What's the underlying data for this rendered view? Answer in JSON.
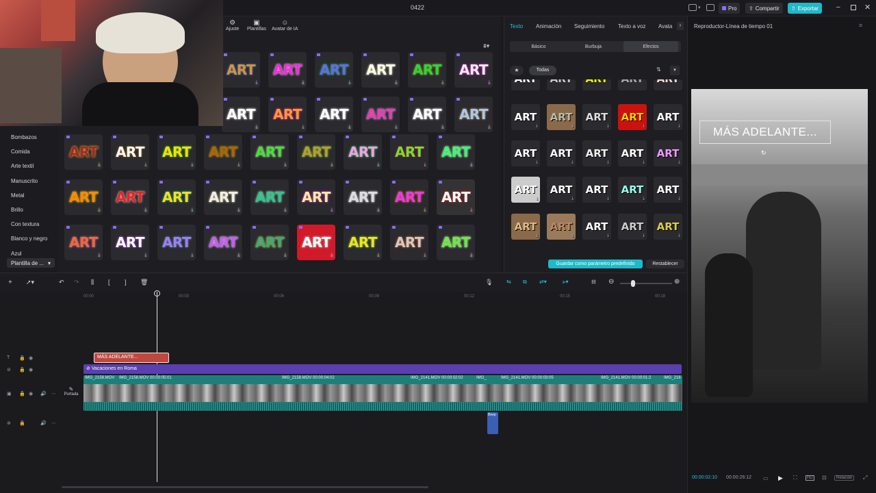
{
  "window": {
    "title": "0422",
    "pro_label": "Pro",
    "share_label": "Compartir",
    "export_label": "Exportar"
  },
  "toolbar": {
    "ajuste": "Ajuste",
    "plantillas": "Plantillas",
    "avatar": "Avatar de IA"
  },
  "categories": [
    "Bombazos",
    "Comida",
    "Arte textil",
    "Manuscrito",
    "Metal",
    "Brillo",
    "Con textura",
    "Blanco y negro",
    "Azul"
  ],
  "category_selected": "Plantilla de ...",
  "art_label": "ART",
  "text_panel": {
    "tabs": [
      "Texto",
      "Animación",
      "Seguimiento",
      "Texto a voz",
      "Avata"
    ],
    "subtabs": [
      "Básico",
      "Burbuja",
      "Efectos"
    ],
    "filter_all": "Todas",
    "save_preset": "Guardar como parámetro predefinido",
    "reset": "Restablecer"
  },
  "player": {
    "title": "Reproductor-Línea de tiempo 01",
    "overlay_text": "MÁS ADELANTE...",
    "current_time": "00:00:02:10",
    "total_time": "00:00:26:12",
    "ratio": "Relación"
  },
  "timeline": {
    "ticks": [
      "00:00",
      "00:03",
      "00:06",
      "00:09",
      "00:12",
      "00:15",
      "00:18"
    ],
    "text_clip": "MÁS ADELANTE...",
    "effect_clip": "Vacaciones en Roma",
    "cover_label": "Portada",
    "clips": [
      {
        "name": "IMG_2158.MOV",
        "dur": ""
      },
      {
        "name": "IMG_2158.MOV",
        "dur": "00:00:05:01"
      },
      {
        "name": "IMG_2158.MOV",
        "dur": "00:00:04:02"
      },
      {
        "name": "IMG_2141.MOV",
        "dur": "00:00:02:02"
      },
      {
        "name": "IMG_",
        "dur": ""
      },
      {
        "name": "IMG_2141.MOV",
        "dur": "00:00:03:05"
      },
      {
        "name": "IMG_2141.MOV",
        "dur": "00:00:01:2"
      },
      {
        "name": "IMG_216",
        "dur": ""
      }
    ],
    "audio_clip": "Beep"
  },
  "colors": {
    "accent": "#25c2d6",
    "text_clip": "#c0473f",
    "effect_clip": "#5b3fb0",
    "video_track": "#1e7f7a"
  }
}
